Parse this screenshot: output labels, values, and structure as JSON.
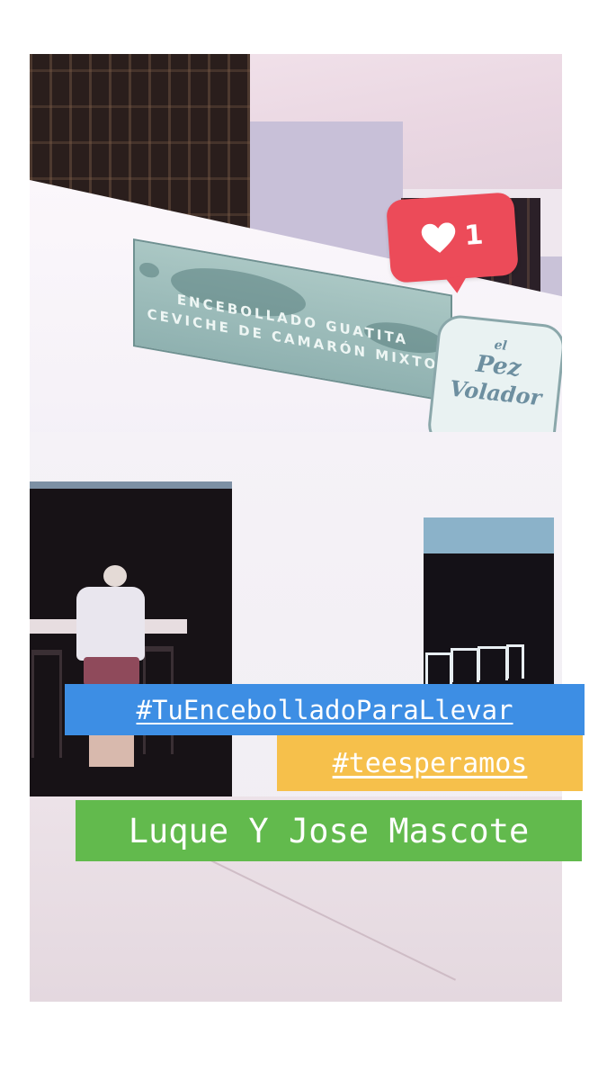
{
  "menu_sign": {
    "line1": "ENCEBOLLADO GUATITA",
    "line2": "CEVICHE DE CAMARÓN MIXTO"
  },
  "logo_sign": {
    "line1": "el",
    "line2": "Pez",
    "line3": "Volador"
  },
  "like_sticker": {
    "icon": "heart-icon",
    "count": "1",
    "color": "#ec4b59"
  },
  "hashtags": [
    {
      "text": "#TuEncebolladoParaLlevar",
      "color": "#3d8ee4"
    },
    {
      "text": "#teesperamos",
      "color": "#f6c04b"
    }
  ],
  "location_text": "Luque Y Jose Mascote",
  "location_color": "#62ba4d"
}
